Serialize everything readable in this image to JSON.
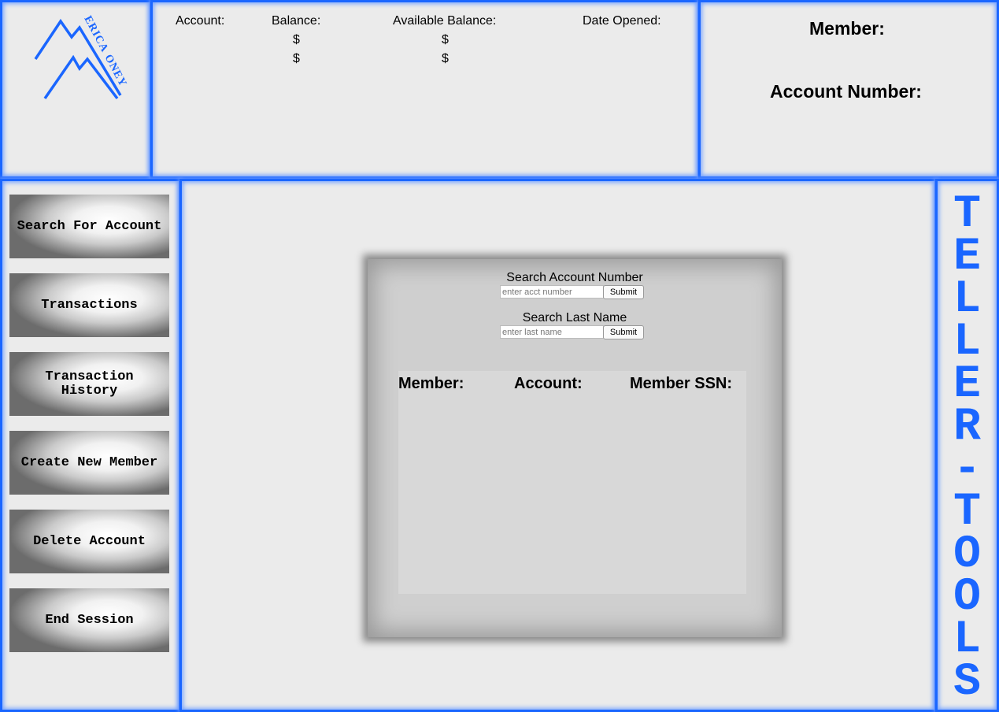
{
  "brand": {
    "logo_text_top": "ERICA",
    "logo_text_bottom": "ONEY",
    "accent_color": "#1a66ff"
  },
  "accounts": {
    "headers": {
      "account": "Account:",
      "balance": "Balance:",
      "available": "Available Balance:",
      "opened": "Date Opened:"
    },
    "rows": [
      {
        "balance": "$",
        "available": "$"
      },
      {
        "balance": "$",
        "available": "$"
      }
    ]
  },
  "member": {
    "member_label": "Member:",
    "account_number_label": "Account Number:"
  },
  "nav": {
    "items": [
      {
        "label": "Search For Account"
      },
      {
        "label": "Transactions"
      },
      {
        "label": "Transaction History"
      },
      {
        "label": "Create New Member"
      },
      {
        "label": "Delete Account"
      },
      {
        "label": "End Session"
      }
    ]
  },
  "search": {
    "account_title": "Search Account Number",
    "account_placeholder": "enter acct number",
    "lastname_title": "Search Last Name",
    "lastname_placeholder": "enter last name",
    "submit_label": "Submit",
    "results_headers": {
      "member": "Member:",
      "account": "Account:",
      "ssn": "Member SSN:"
    }
  },
  "side_title": "TELLER-TOOLS"
}
